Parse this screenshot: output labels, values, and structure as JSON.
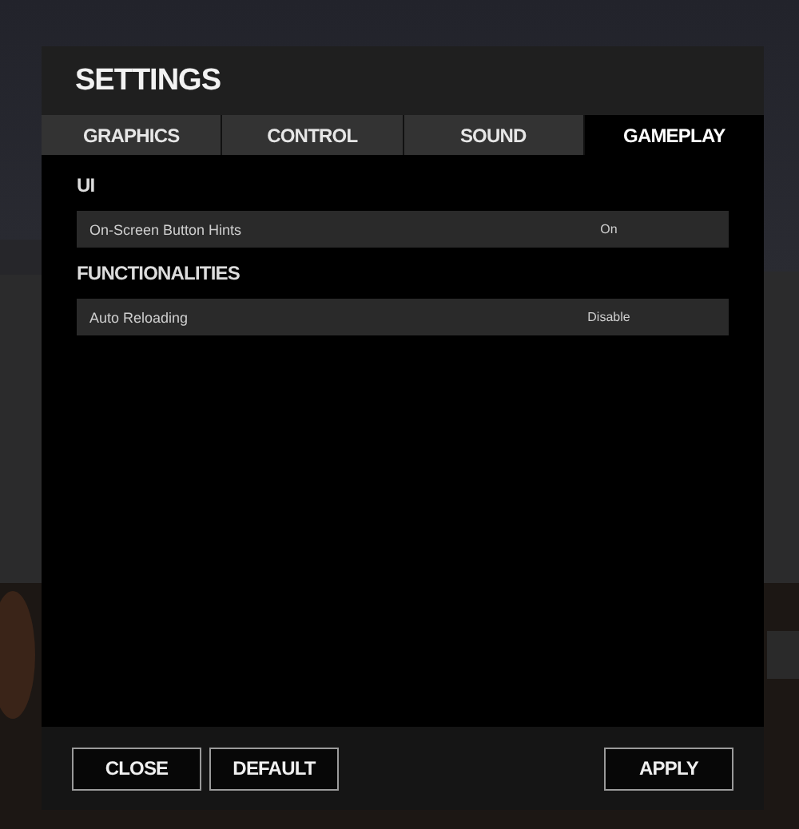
{
  "window": {
    "title": "SETTINGS"
  },
  "tabs": [
    {
      "label": "GRAPHICS",
      "selected": false
    },
    {
      "label": "CONTROL",
      "selected": false
    },
    {
      "label": "SOUND",
      "selected": false
    },
    {
      "label": "GAMEPLAY",
      "selected": true
    }
  ],
  "sections": [
    {
      "title": "UI",
      "options": [
        {
          "label": "On-Screen Button Hints",
          "value": "On"
        }
      ]
    },
    {
      "title": "FUNCTIONALITIES",
      "options": [
        {
          "label": "Auto Reloading",
          "value": "Disable"
        }
      ]
    }
  ],
  "footer": {
    "left_buttons": [
      "CLOSE",
      "DEFAULT"
    ],
    "right_buttons": [
      "APPLY"
    ]
  }
}
